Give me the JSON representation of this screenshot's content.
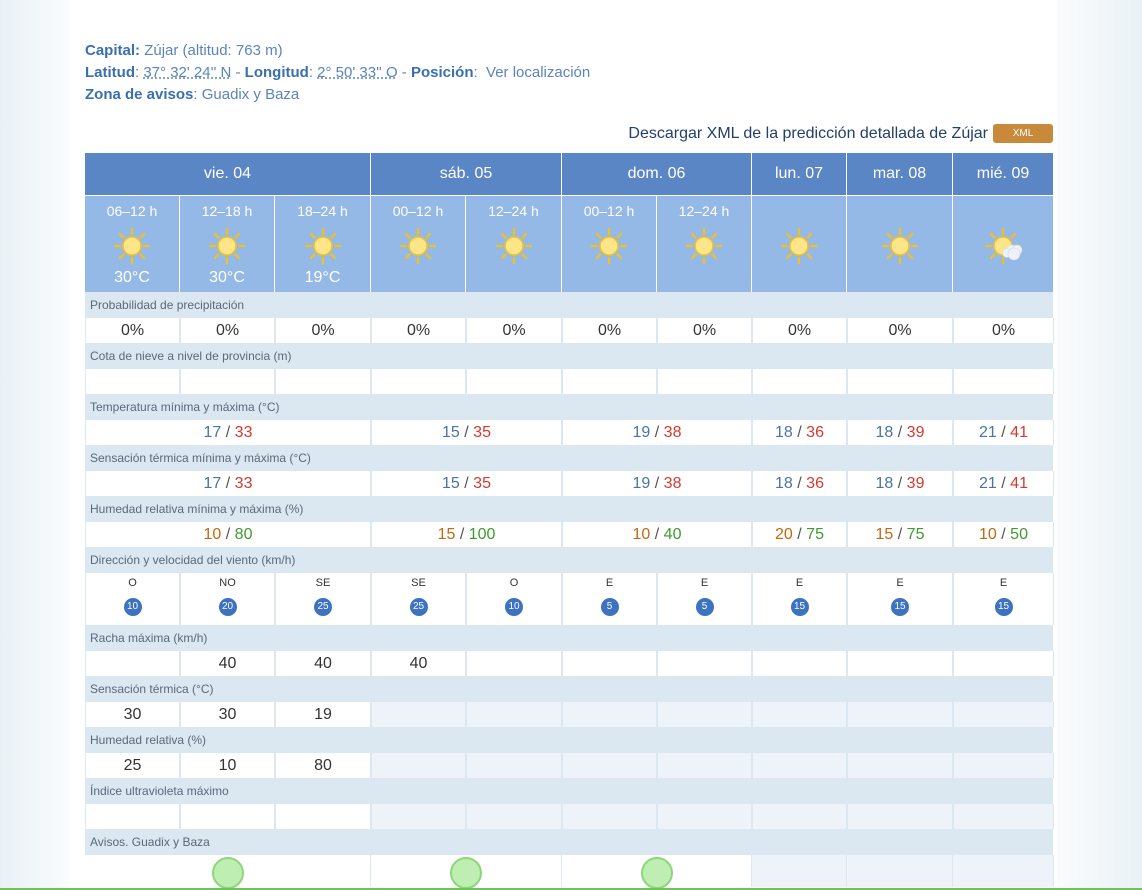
{
  "info": {
    "capital_label": "Capital:",
    "capital_value": "Zújar (altitud: 763 m)",
    "lat_label": "Latitud",
    "lat_value": "37° 32' 24'' N",
    "lon_label": "Longitud",
    "lon_value": "2° 50' 33'' O",
    "pos_label": "Posición",
    "pos_value": "Ver localización",
    "zona_label": "Zona de avisos",
    "zona_value": "Guadix y Baza"
  },
  "xml": {
    "text": "Descargar XML de la predicción detallada de Zújar",
    "button": "XML"
  },
  "days": [
    "vie. 04",
    "sáb. 05",
    "dom. 06",
    "lun. 07",
    "mar. 08",
    "mié. 09"
  ],
  "periods": [
    {
      "label": "06–12 h",
      "icon": "sun-icon",
      "temp": "30°C"
    },
    {
      "label": "12–18 h",
      "icon": "sun-icon",
      "temp": "30°C"
    },
    {
      "label": "18–24 h",
      "icon": "sun-icon",
      "temp": "19°C"
    },
    {
      "label": "00–12 h",
      "icon": "sun-icon",
      "temp": ""
    },
    {
      "label": "12–24 h",
      "icon": "sun-icon",
      "temp": ""
    },
    {
      "label": "00–12 h",
      "icon": "sun-icon",
      "temp": ""
    },
    {
      "label": "12–24 h",
      "icon": "sun-icon",
      "temp": ""
    },
    {
      "label": "",
      "icon": "sun-icon",
      "temp": ""
    },
    {
      "label": "",
      "icon": "sun-icon",
      "temp": ""
    },
    {
      "label": "",
      "icon": "sun-cloud-icon",
      "temp": ""
    }
  ],
  "labels": {
    "precip": "Probabilidad de precipitación",
    "snow": "Cota de nieve a nivel de provincia (m)",
    "temp": "Temperatura mínima y máxima (°C)",
    "sens": "Sensación térmica mínima y máxima (°C)",
    "hum": "Humedad relativa mínima y máxima (%)",
    "wind": "Dirección y velocidad del viento (km/h)",
    "gust": "Racha máxima (km/h)",
    "sens2": "Sensación térmica (°C)",
    "hum2": "Humedad relativa (%)",
    "uv": "Índice ultravioleta máximo",
    "warn": "Avisos. Guadix y Baza"
  },
  "precip": [
    "0%",
    "0%",
    "0%",
    "0%",
    "0%",
    "0%",
    "0%",
    "0%",
    "0%",
    "0%"
  ],
  "temp": [
    {
      "min": "17",
      "max": "33"
    },
    {
      "min": "15",
      "max": "35"
    },
    {
      "min": "19",
      "max": "38"
    },
    {
      "min": "18",
      "max": "36"
    },
    {
      "min": "18",
      "max": "39"
    },
    {
      "min": "21",
      "max": "41"
    }
  ],
  "sens": [
    {
      "min": "17",
      "max": "33"
    },
    {
      "min": "15",
      "max": "35"
    },
    {
      "min": "19",
      "max": "38"
    },
    {
      "min": "18",
      "max": "36"
    },
    {
      "min": "18",
      "max": "39"
    },
    {
      "min": "21",
      "max": "41"
    }
  ],
  "hum": [
    {
      "min": "10",
      "max": "80"
    },
    {
      "min": "15",
      "max": "100"
    },
    {
      "min": "10",
      "max": "40"
    },
    {
      "min": "20",
      "max": "75"
    },
    {
      "min": "15",
      "max": "75"
    },
    {
      "min": "10",
      "max": "50"
    }
  ],
  "wind": [
    {
      "dir": "O",
      "speed": "10"
    },
    {
      "dir": "NO",
      "speed": "20"
    },
    {
      "dir": "SE",
      "speed": "25"
    },
    {
      "dir": "SE",
      "speed": "25"
    },
    {
      "dir": "O",
      "speed": "10"
    },
    {
      "dir": "E",
      "speed": "5"
    },
    {
      "dir": "E",
      "speed": "5"
    },
    {
      "dir": "E",
      "speed": "15"
    },
    {
      "dir": "E",
      "speed": "15"
    },
    {
      "dir": "E",
      "speed": "15"
    }
  ],
  "gust": [
    "",
    "40",
    "40",
    "40",
    "",
    "",
    "",
    "",
    "",
    ""
  ],
  "sens2": [
    "30",
    "30",
    "19"
  ],
  "hum2": [
    "25",
    "10",
    "80"
  ],
  "colors": {
    "day_header": "#5b86c6",
    "period_header": "#95b9e7",
    "label_bg": "#dbe7f1",
    "tmax": "#d53a2f",
    "warn_green": "#8bd77a"
  }
}
